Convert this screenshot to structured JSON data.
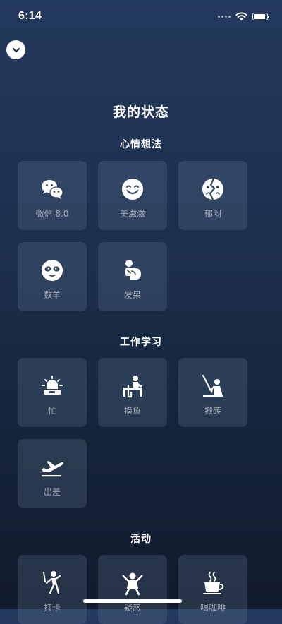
{
  "status_bar": {
    "time": "6:14",
    "icons": [
      "signal-dots-icon",
      "wifi-icon",
      "battery-icon"
    ],
    "battery_level_percent": 90
  },
  "collapse_button": {
    "icon": "chevron-down-icon"
  },
  "page": {
    "title": "我的状态"
  },
  "sections": [
    {
      "title": "心情想法",
      "items": [
        {
          "label": "微信 8.0",
          "icon": "wechat-icon"
        },
        {
          "label": "美滋滋",
          "icon": "smile-icon"
        },
        {
          "label": "郁闷",
          "icon": "broken-face-icon"
        },
        {
          "label": "数羊",
          "icon": "sheep-face-icon"
        },
        {
          "label": "发呆",
          "icon": "daze-icon"
        }
      ]
    },
    {
      "title": "工作学习",
      "items": [
        {
          "label": "忙",
          "icon": "alarm-laptop-icon"
        },
        {
          "label": "摸鱼",
          "icon": "desk-person-icon"
        },
        {
          "label": "搬砖",
          "icon": "shovel-worker-icon"
        },
        {
          "label": "出差",
          "icon": "airplane-icon"
        }
      ]
    },
    {
      "title": "活动",
      "items": [
        {
          "label": "打卡",
          "icon": "walking-icon"
        },
        {
          "label": "疑惑",
          "icon": "cheering-person-icon"
        },
        {
          "label": "喝咖啡",
          "icon": "coffee-cup-icon"
        }
      ]
    }
  ],
  "colors": {
    "background_top": "#23395d",
    "background_bottom": "#111b2b",
    "tile_background": "#3a4a63",
    "label_text": "#9aa6b6"
  }
}
